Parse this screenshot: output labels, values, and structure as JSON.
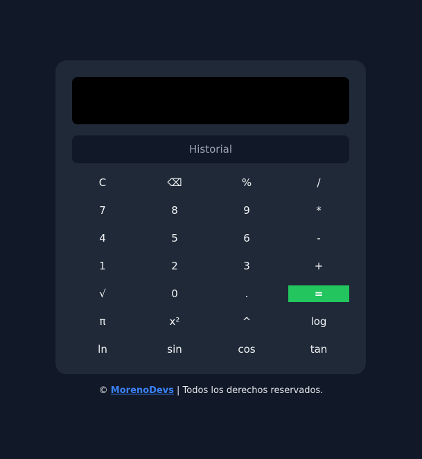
{
  "display": {
    "value": ""
  },
  "history": {
    "label": "Historial"
  },
  "keys": [
    {
      "label": "C",
      "name": "clear-button"
    },
    {
      "label": "⌫",
      "name": "backspace-button"
    },
    {
      "label": "%",
      "name": "percent-button"
    },
    {
      "label": "/",
      "name": "divide-button"
    },
    {
      "label": "7",
      "name": "digit-7-button"
    },
    {
      "label": "8",
      "name": "digit-8-button"
    },
    {
      "label": "9",
      "name": "digit-9-button"
    },
    {
      "label": "*",
      "name": "multiply-button"
    },
    {
      "label": "4",
      "name": "digit-4-button"
    },
    {
      "label": "5",
      "name": "digit-5-button"
    },
    {
      "label": "6",
      "name": "digit-6-button"
    },
    {
      "label": "-",
      "name": "subtract-button"
    },
    {
      "label": "1",
      "name": "digit-1-button"
    },
    {
      "label": "2",
      "name": "digit-2-button"
    },
    {
      "label": "3",
      "name": "digit-3-button"
    },
    {
      "label": "+",
      "name": "add-button"
    },
    {
      "label": "√",
      "name": "sqrt-button"
    },
    {
      "label": "0",
      "name": "digit-0-button"
    },
    {
      "label": ".",
      "name": "decimal-button"
    },
    {
      "label": "=",
      "name": "equals-button"
    },
    {
      "label": "π",
      "name": "pi-button"
    },
    {
      "label": "x²",
      "name": "square-button"
    },
    {
      "label": "^",
      "name": "power-button"
    },
    {
      "label": "log",
      "name": "log-button"
    },
    {
      "label": "ln",
      "name": "ln-button"
    },
    {
      "label": "sin",
      "name": "sin-button"
    },
    {
      "label": "cos",
      "name": "cos-button"
    },
    {
      "label": "tan",
      "name": "tan-button"
    }
  ],
  "footer": {
    "copyright": "©",
    "brand": "MorenoDevs",
    "rights": "| Todos los derechos reservados."
  },
  "colors": {
    "page_background": "#111827",
    "panel_background": "#1f2937",
    "display_background": "#000000",
    "equals_accent": "#22c55e",
    "link": "#3b82f6"
  }
}
